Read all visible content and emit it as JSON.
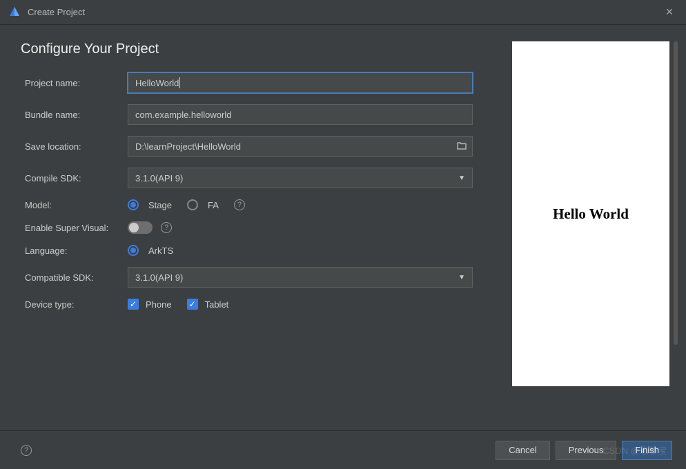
{
  "window": {
    "title": "Create Project"
  },
  "heading": "Configure Your Project",
  "labels": {
    "project_name": "Project name:",
    "bundle_name": "Bundle name:",
    "save_location": "Save location:",
    "compile_sdk": "Compile SDK:",
    "model": "Model:",
    "enable_super_visual": "Enable Super Visual:",
    "language": "Language:",
    "compatible_sdk": "Compatible SDK:",
    "device_type": "Device type:"
  },
  "values": {
    "project_name": "HelloWorld",
    "bundle_name": "com.example.helloworld",
    "save_location": "D:\\learnProject\\HelloWorld",
    "compile_sdk": "3.1.0(API 9)",
    "compatible_sdk": "3.1.0(API 9)"
  },
  "model": {
    "stage": "Stage",
    "fa": "FA",
    "selected": "stage"
  },
  "enable_super_visual": false,
  "language": {
    "arkts": "ArkTS",
    "selected": "arkts"
  },
  "device_type": {
    "phone": "Phone",
    "tablet": "Tablet",
    "phone_checked": true,
    "tablet_checked": true
  },
  "preview": {
    "text": "Hello World"
  },
  "buttons": {
    "cancel": "Cancel",
    "previous": "Previous",
    "finish": "Finish"
  },
  "watermark": "CSDN @志尊宝"
}
